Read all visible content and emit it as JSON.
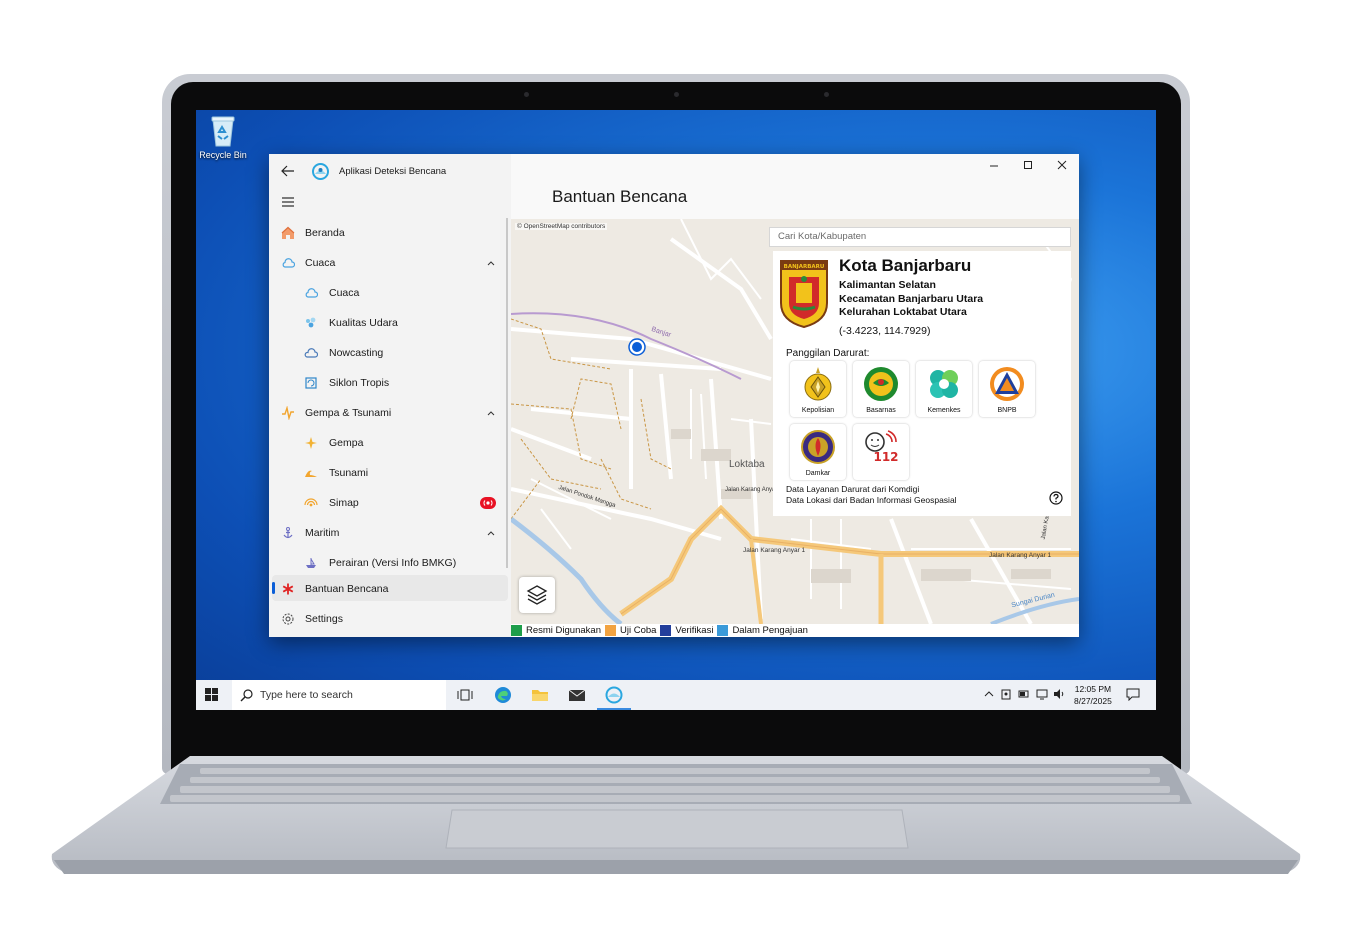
{
  "desktop": {
    "recycle_bin_label": "Recycle Bin"
  },
  "app": {
    "title": "Aplikasi Deteksi Bencana",
    "nav": {
      "items": [
        {
          "label": "Beranda",
          "icon": "home-icon",
          "level": 0
        },
        {
          "label": "Cuaca",
          "icon": "cloud-icon",
          "level": 0,
          "expanded": true
        },
        {
          "label": "Cuaca",
          "icon": "cloud-icon",
          "level": 1
        },
        {
          "label": "Kualitas Udara",
          "icon": "air-quality-icon",
          "level": 1
        },
        {
          "label": "Nowcasting",
          "icon": "nowcasting-icon",
          "level": 1
        },
        {
          "label": "Siklon Tropis",
          "icon": "cyclone-icon",
          "level": 1
        },
        {
          "label": "Gempa & Tsunami",
          "icon": "earthquake-icon",
          "level": 0,
          "expanded": true
        },
        {
          "label": "Gempa",
          "icon": "earthquake-icon",
          "level": 1
        },
        {
          "label": "Tsunami",
          "icon": "tsunami-icon",
          "level": 1
        },
        {
          "label": "Simap",
          "icon": "signal-icon",
          "level": 1,
          "badge": "live-badge"
        },
        {
          "label": "Maritim",
          "icon": "anchor-icon",
          "level": 0,
          "expanded": true
        },
        {
          "label": "Perairan (Versi Info BMKG)",
          "icon": "ship-icon",
          "level": 1
        }
      ],
      "bantuan_label": "Bantuan Bencana",
      "settings_label": "Settings"
    },
    "page_title": "Bantuan Bencana",
    "map": {
      "credit": "© OpenStreetMap contributors",
      "search_placeholder": "Cari Kota/Kabupaten",
      "labels": {
        "banjar": "Banjar",
        "loktaba": "Loktaba",
        "jalan_pondok_mangga": "Jalan Pondok Mangga",
        "jalan_karang_anyar_1": "Jalan Karang Anyar 1",
        "jalan_karang_anyar_1b": "Jalan Karang Anyar 1",
        "jalan_karang_anyar_3": "Jalan Karang Anyar 3",
        "jalan_karang": "Jalan Karang",
        "sungai_durian": "Sungai Durian"
      }
    },
    "info": {
      "city": "Kota Banjarbaru",
      "logo_text": "BANJARBARU",
      "province": "Kalimantan Selatan",
      "district": "Kecamatan Banjarbaru Utara",
      "village": "Kelurahan Loktabat Utara",
      "coords": "(-3.4223, 114.7929)",
      "emergency_title": "Panggilan Darurat:",
      "services": [
        {
          "label": "Kepolisian",
          "icon": "police-emblem-icon"
        },
        {
          "label": "Basarnas",
          "icon": "basarnas-emblem-icon"
        },
        {
          "label": "Kemenkes",
          "icon": "kemenkes-emblem-icon"
        },
        {
          "label": "BNPB",
          "icon": "bnpb-emblem-icon"
        },
        {
          "label": "Damkar",
          "icon": "damkar-emblem-icon"
        },
        {
          "label": "",
          "icon": "call-112-icon"
        }
      ],
      "emergency_number": "112",
      "credit_line1": "Data Layanan Darurat dari Komdigi",
      "credit_line2": "Data Lokasi dari Badan Informasi Geospasial"
    },
    "legend": [
      {
        "label": "Resmi Digunakan",
        "color": "#1e9e4a"
      },
      {
        "label": "Uji Coba",
        "color": "#f2a341"
      },
      {
        "label": "Verifikasi",
        "color": "#233f9c"
      },
      {
        "label": "Dalam Pengajuan",
        "color": "#3a9ad9"
      }
    ]
  },
  "taskbar": {
    "search_placeholder": "Type here to search",
    "time": "12:05 PM",
    "date": "8/27/2025"
  },
  "colors": {
    "accent": "#0b5ed7",
    "desktop": "#1b74d8"
  }
}
